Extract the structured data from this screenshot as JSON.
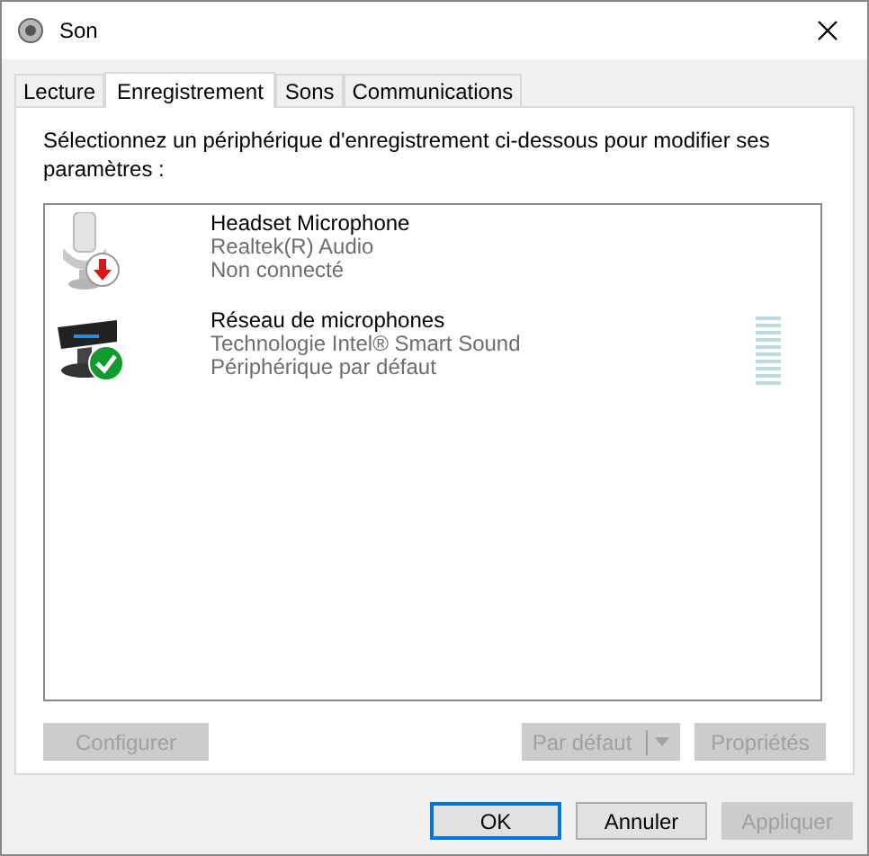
{
  "window": {
    "title": "Son"
  },
  "tabs": [
    {
      "label": "Lecture",
      "selected": false
    },
    {
      "label": "Enregistrement",
      "selected": true
    },
    {
      "label": "Sons",
      "selected": false
    },
    {
      "label": "Communications",
      "selected": false
    }
  ],
  "instruction": "Sélectionnez un périphérique d'enregistrement ci-dessous pour modifier ses paramètres :",
  "devices": [
    {
      "kind": "headset",
      "name": "Headset Microphone",
      "driver": "Realtek(R) Audio",
      "status": "Non connecté",
      "connected": false
    },
    {
      "kind": "array",
      "name": "Réseau de microphones",
      "driver": "Technologie Intel® Smart Sound",
      "status": "Périphérique par défaut",
      "connected": true,
      "meter": true
    }
  ],
  "device_buttons": [
    {
      "label": "Configurer",
      "disabled": true
    },
    {
      "label": "Par défaut",
      "disabled": true,
      "kind": "split"
    },
    {
      "label": "Propriétés",
      "disabled": true
    }
  ],
  "dialog_buttons": [
    {
      "label": "OK",
      "disabled": false,
      "default": true
    },
    {
      "label": "Annuler",
      "disabled": false,
      "default": false
    },
    {
      "label": "Appliquer",
      "disabled": true,
      "default": false
    }
  ]
}
